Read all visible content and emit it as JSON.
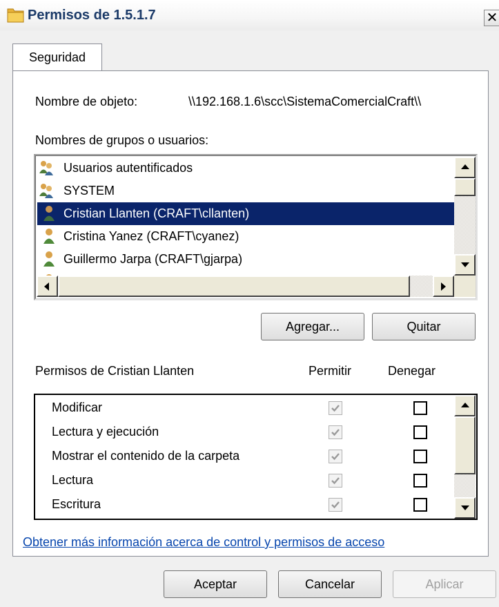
{
  "window": {
    "title": "Permisos de 1.5.1.7",
    "close_glyph": "✕"
  },
  "tabs": [
    {
      "label": "Seguridad"
    }
  ],
  "object": {
    "label": "Nombre de objeto:",
    "value": "\\\\192.168.1.6\\scc\\SistemaComercialCraft\\\\"
  },
  "groups": {
    "label": "Nombres de grupos o usuarios:",
    "items": [
      {
        "label": "Usuarios autentificados",
        "icon": "users-group-icon",
        "selected": false
      },
      {
        "label": "SYSTEM",
        "icon": "users-group-icon",
        "selected": false
      },
      {
        "label": "Cristian Llanten (CRAFT\\cllanten)",
        "icon": "user-icon",
        "selected": true
      },
      {
        "label": "Cristina Yanez (CRAFT\\cyanez)",
        "icon": "user-icon",
        "selected": false
      },
      {
        "label": "Guillermo Jarpa (CRAFT\\gjarpa)",
        "icon": "user-icon",
        "selected": false
      }
    ]
  },
  "buttons": {
    "add": "Agregar...",
    "remove": "Quitar",
    "ok": "Aceptar",
    "cancel": "Cancelar",
    "apply": "Aplicar"
  },
  "permissions": {
    "label": "Permisos de Cristian Llanten",
    "allow_header": "Permitir",
    "deny_header": "Denegar",
    "items": [
      {
        "label": "Modificar",
        "allow": true,
        "deny": false
      },
      {
        "label": "Lectura y ejecución",
        "allow": true,
        "deny": false
      },
      {
        "label": "Mostrar el contenido de la carpeta",
        "allow": true,
        "deny": false
      },
      {
        "label": "Lectura",
        "allow": true,
        "deny": false
      },
      {
        "label": "Escritura",
        "allow": true,
        "deny": false
      }
    ]
  },
  "link": {
    "text": "Obtener más información acerca de control y permisos de acceso"
  },
  "colors": {
    "selection": "#0a246a",
    "title_text": "#1b3a68",
    "link": "#0645ad"
  }
}
